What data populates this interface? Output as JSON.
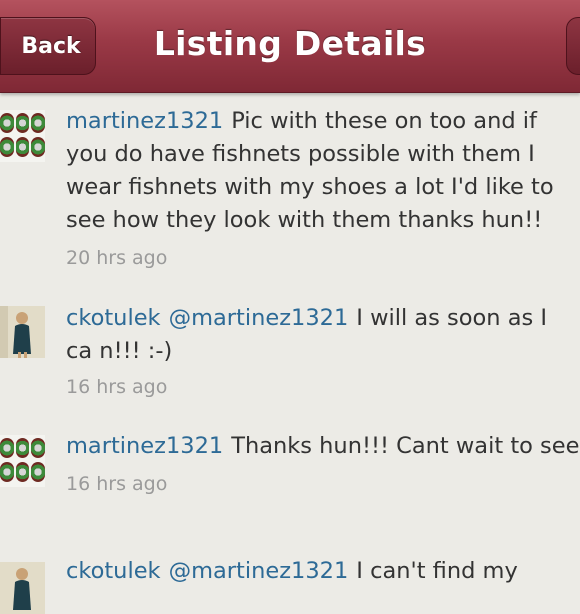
{
  "navbar": {
    "title": "Listing Details",
    "back_label": "Back"
  },
  "comments": [
    {
      "user": "martinez1321",
      "lines": [
        "Pic with these on too and if",
        "you do have fishnets possible with them I",
        "wear fishnets with my shoes a lot I'd like to",
        "see how they look with them thanks hun!!"
      ],
      "time": "20 hrs ago",
      "avatar": "melon-collage-avatar"
    },
    {
      "user": "ckotulek",
      "mention": "@martinez1321",
      "lines": [
        "I will as soon as I",
        "ca n!!!    :-)"
      ],
      "time": "16 hrs ago",
      "avatar": "person-photo-avatar"
    },
    {
      "user": "martinez1321",
      "lines": [
        "Thanks hun!!! Cant wait to see"
      ],
      "time": "16 hrs ago",
      "avatar": "melon-collage-avatar"
    },
    {
      "user": "ckotulek",
      "mention": "@martinez1321",
      "lines": [
        "I can't find my"
      ],
      "time": "",
      "avatar": "person-photo-avatar"
    }
  ]
}
